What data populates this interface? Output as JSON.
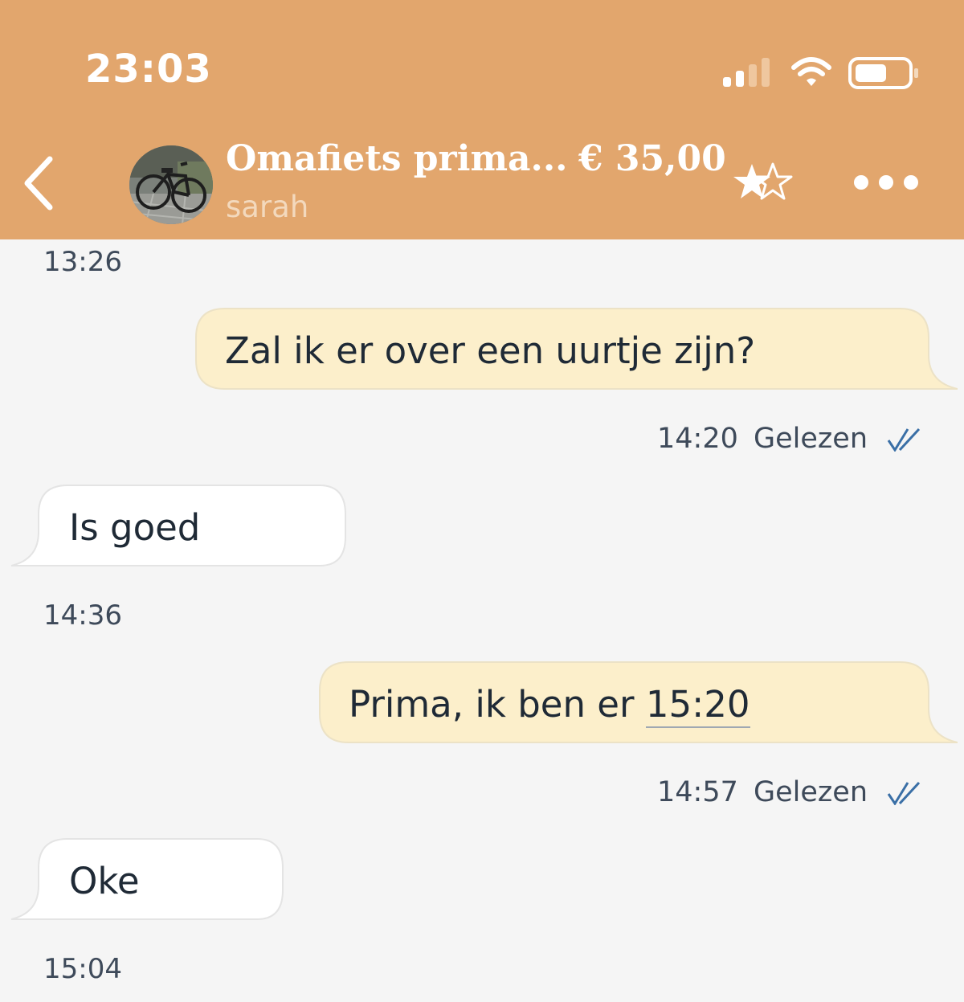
{
  "status_bar": {
    "time": "23:03"
  },
  "header": {
    "title": "Omafiets prima...",
    "price": "€ 35,00",
    "seller": "sarah",
    "accent_color": "#e2a66d"
  },
  "messages": [
    {
      "type": "timestamp",
      "text": "13:26"
    },
    {
      "type": "outgoing",
      "text": "Zal ik er over een uurtje zijn?",
      "time": "14:20",
      "status": "Gelezen"
    },
    {
      "type": "incoming",
      "text": "Is goed",
      "time": "14:36"
    },
    {
      "type": "outgoing",
      "text_prefix": "Prima, ik ben er ",
      "text_link": "15:20",
      "time": "14:57",
      "status": "Gelezen"
    },
    {
      "type": "incoming",
      "text": "Oke",
      "time": "15:04"
    }
  ],
  "colors": {
    "outgoing_bubble": "#fcefcb",
    "incoming_bubble": "#ffffff",
    "background": "#f5f5f5",
    "read_check": "#3a6fa6"
  }
}
